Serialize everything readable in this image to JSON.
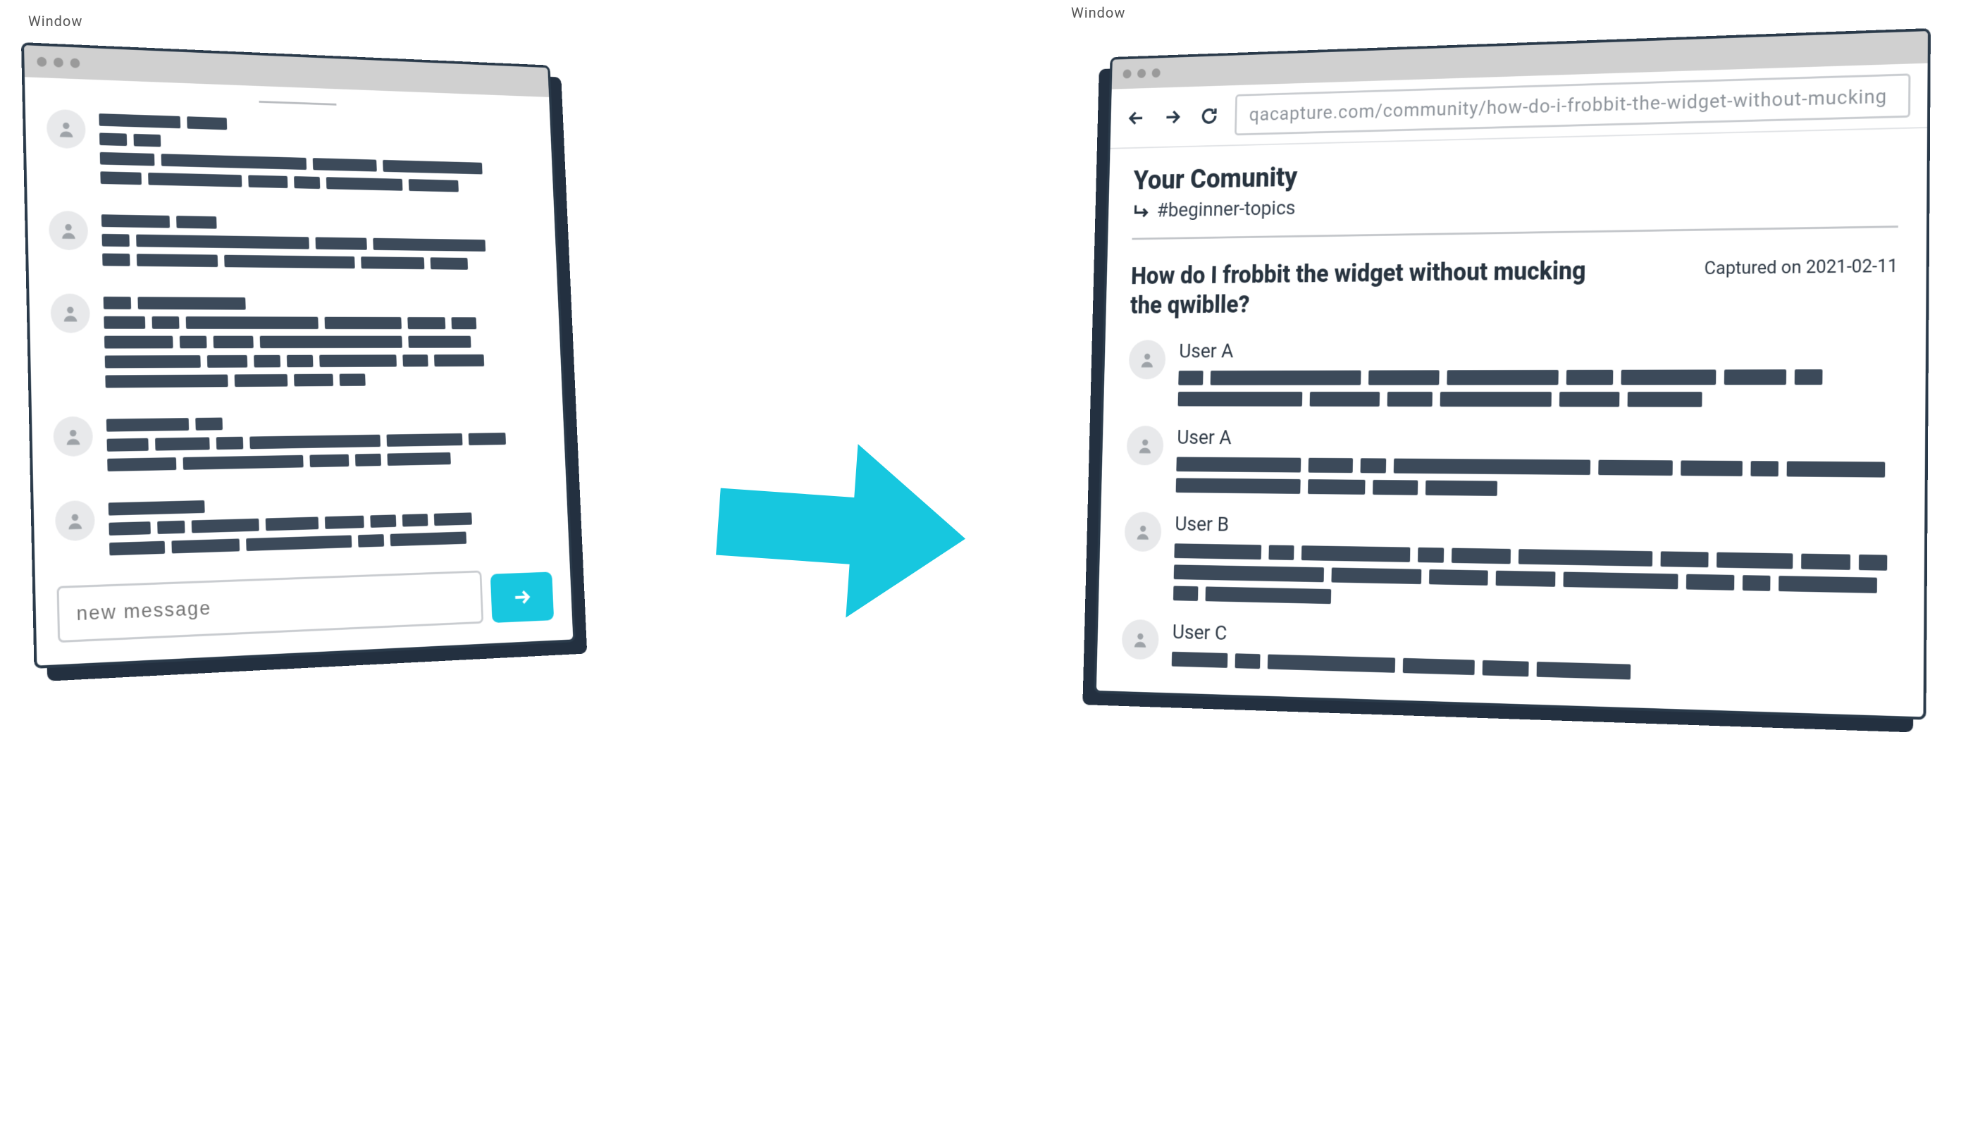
{
  "leftWindow": {
    "label": "Window",
    "compose": {
      "placeholder": "new message"
    }
  },
  "rightWindow": {
    "label": "Window",
    "url": "qacapture.com/community/how-do-i-frobbit-the-widget-without-mucking",
    "community": {
      "title": "Your Comunity",
      "channel": "#beginner-topics"
    },
    "thread": {
      "title": "How do I frobbit the widget without mucking the qwiblle?",
      "captured": "Captured on 2021-02-11",
      "posts": [
        {
          "user": "User A"
        },
        {
          "user": "User A"
        },
        {
          "user": "User B"
        },
        {
          "user": "User C"
        }
      ]
    }
  }
}
